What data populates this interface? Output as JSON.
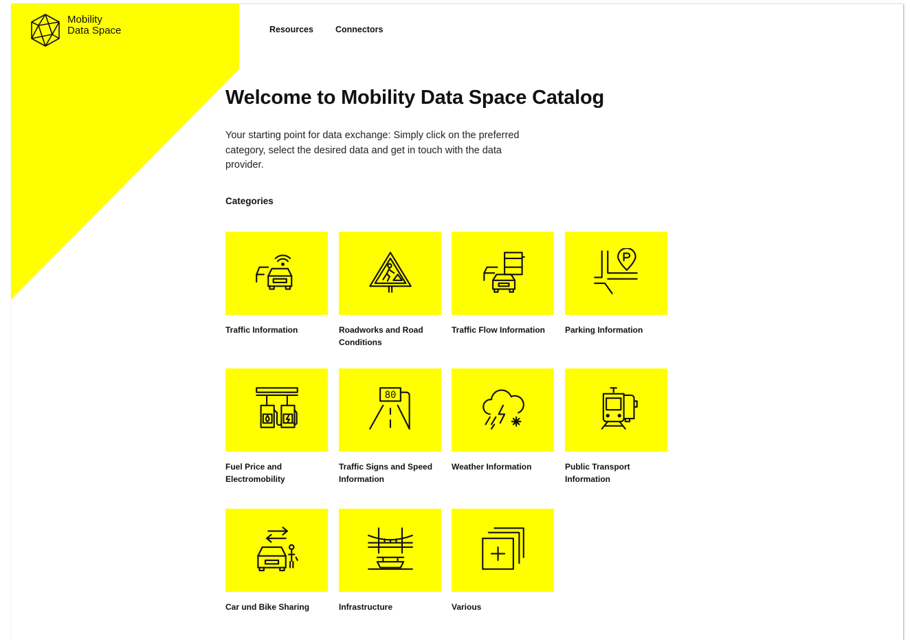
{
  "brand": {
    "line1": "Mobility",
    "line2": "Data Space"
  },
  "nav": [
    {
      "label": "Resources"
    },
    {
      "label": "Connectors"
    }
  ],
  "hero": {
    "title": "Welcome to Mobility Data Space Catalog",
    "intro": "Your starting point for data exchange: Simply click on the preferred category, select the desired data and get in touch with the data provider."
  },
  "categories_heading": "Categories",
  "categories": [
    {
      "label": "Traffic Information",
      "icon": "traffic-info-icon"
    },
    {
      "label": "Roadworks and Road Conditions",
      "icon": "roadworks-icon"
    },
    {
      "label": "Traffic Flow Information",
      "icon": "traffic-flow-icon"
    },
    {
      "label": "Parking Information",
      "icon": "parking-icon"
    },
    {
      "label": "Fuel Price and Electromobility",
      "icon": "fuel-station-icon"
    },
    {
      "label": "Traffic Signs and Speed Information",
      "icon": "speed-sign-icon",
      "sign_text": "80"
    },
    {
      "label": "Weather Information",
      "icon": "weather-icon"
    },
    {
      "label": "Public Transport Information",
      "icon": "tram-bus-icon"
    },
    {
      "label": "Car und Bike Sharing",
      "icon": "car-bike-sharing-icon"
    },
    {
      "label": "Infrastructure",
      "icon": "bridge-icon"
    },
    {
      "label": "Various",
      "icon": "stacked-squares-plus-icon"
    }
  ],
  "colors": {
    "accent": "#ffff00",
    "text": "#111111"
  }
}
